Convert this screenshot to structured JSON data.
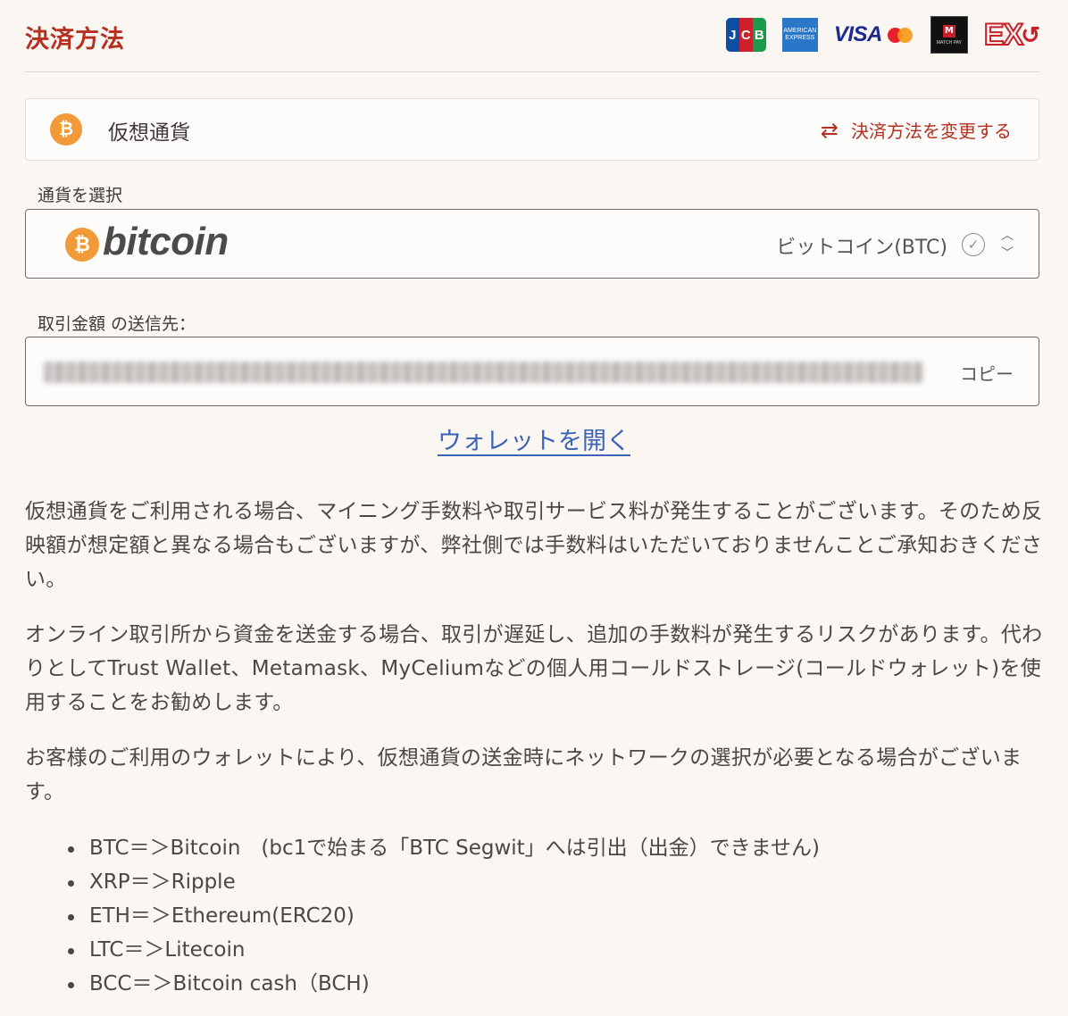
{
  "header": {
    "title": "決済方法",
    "brands": {
      "jcb": [
        "J",
        "C",
        "B"
      ],
      "amex": [
        "AMERICAN",
        "EXPRESS"
      ],
      "visa": "VISA",
      "matchpay": "MATCH PAY",
      "ex": "EX"
    }
  },
  "method": {
    "badge": "₿",
    "label": "仮想通貨",
    "change_link": "決済方法を変更する"
  },
  "currency": {
    "label": "通貨を選択",
    "logo_text": "bitcoin",
    "selected": "ビットコイン(BTC)"
  },
  "address": {
    "label": "取引金額 の送信先：",
    "copy_label": "コピー"
  },
  "wallet_link": "ウォレットを開く",
  "paragraphs": [
    "仮想通貨をご利用される場合、マイニング手数料や取引サービス料が発生することがございます。そのため反映額が想定額と異なる場合もございますが、弊社側では手数料はいただいておりませんことご承知おきください。",
    "オンライン取引所から資金を送金する場合、取引が遅延し、追加の手数料が発生するリスクがあります。代わりとしてTrust Wallet、Metamask、MyCeliumなどの個人用コールドストレージ(コールドウォレット)を使用することをお勧めします。",
    "お客様のご利用のウォレットにより、仮想通貨の送金時にネットワークの選択が必要となる場合がございます。"
  ],
  "networks": [
    "BTC＝＞Bitcoin　(bc1で始まる「BTC Segwit」へは引出（出金）できません)",
    "XRP＝＞Ripple",
    "ETH＝＞Ethereum(ERC20)",
    "LTC＝＞Litecoin",
    "BCC＝＞Bitcoin cash（BCH)"
  ],
  "colors": {
    "accent": "#b5301f",
    "link": "#3c63b5",
    "bitcoin": "#f29a38",
    "background": "#faf6f2"
  },
  "icons": {
    "swap": "swap-icon",
    "check": "check-circle-icon",
    "select": "chevron-updown-icon"
  }
}
